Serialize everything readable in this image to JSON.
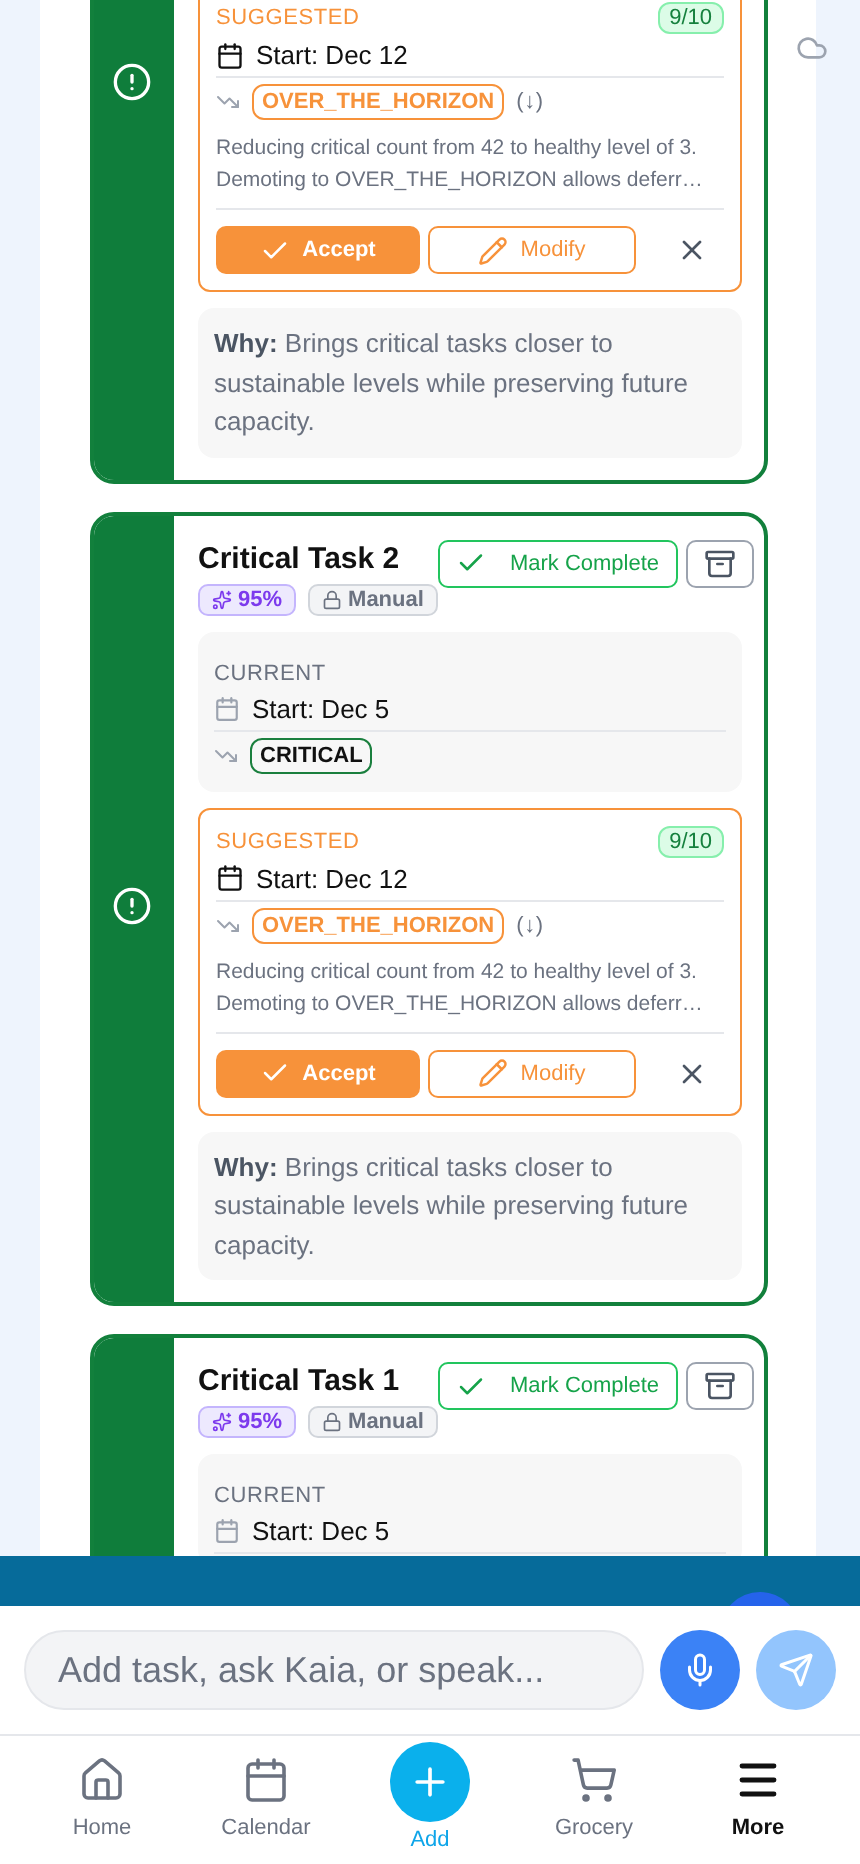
{
  "tasks": [
    {
      "suggested": {
        "label": "SUGGESTED",
        "score": "9/10",
        "start": "Start: Dec 12",
        "priority": "OVER_THE_HORIZON",
        "direction": "(↓)",
        "reason": "Reducing critical count from 42 to healthy level of 3. Demoting to OVER_THE_HORIZON allows deferr…",
        "accept": "Accept",
        "modify": "Modify"
      },
      "why": "**Why:** Brings critical tasks closer to sustainable levels while preserving future capacity."
    },
    {
      "title": "Critical Task 2",
      "confidence": "95%",
      "mode": "Manual",
      "complete": "Mark Complete",
      "current": {
        "label": "CURRENT",
        "start": "Start: Dec 5",
        "priority": "CRITICAL"
      },
      "suggested": {
        "label": "SUGGESTED",
        "score": "9/10",
        "start": "Start: Dec 12",
        "priority": "OVER_THE_HORIZON",
        "direction": "(↓)",
        "reason": "Reducing critical count from 42 to healthy level of 3. Demoting to OVER_THE_HORIZON allows deferr…",
        "accept": "Accept",
        "modify": "Modify"
      },
      "why": "**Why:** Brings critical tasks closer to sustainable levels while preserving future capacity."
    },
    {
      "title": "Critical Task 1",
      "confidence": "95%",
      "mode": "Manual",
      "complete": "Mark Complete",
      "current": {
        "label": "CURRENT",
        "start": "Start: Dec 5"
      }
    }
  ],
  "composer": {
    "placeholder": "Add task, ask Kaia, or speak..."
  },
  "nav": [
    {
      "label": "Home",
      "kind": "tab",
      "selected": false
    },
    {
      "label": "Calendar",
      "kind": "tab",
      "selected": false
    },
    {
      "label": "Add",
      "kind": "add",
      "selected": false
    },
    {
      "label": "Grocery",
      "kind": "tab",
      "selected": false
    },
    {
      "label": "More",
      "kind": "tab",
      "selected": true
    }
  ]
}
